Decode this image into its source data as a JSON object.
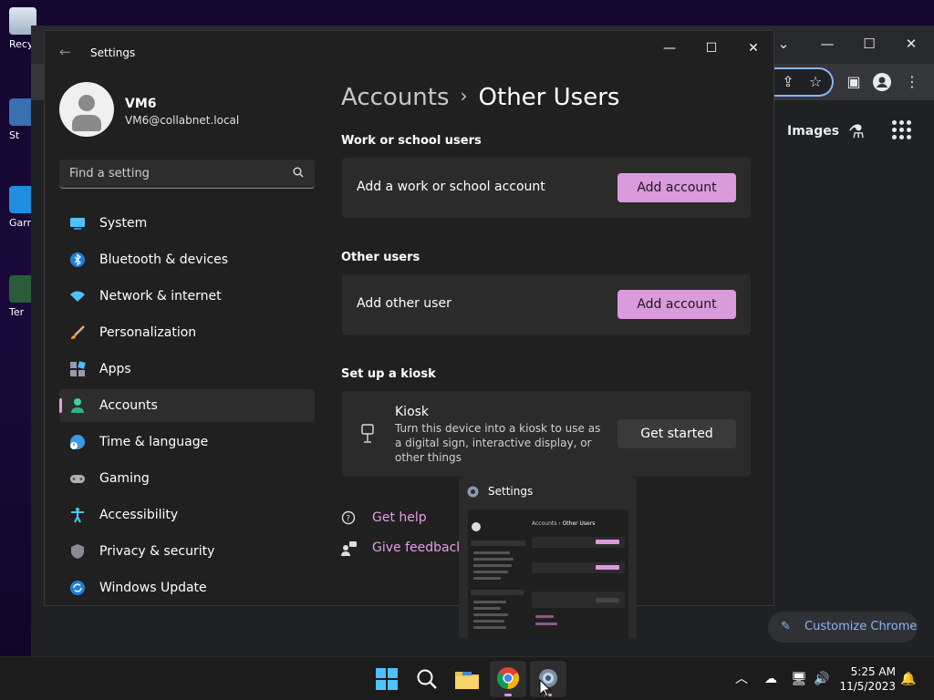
{
  "desktop": {
    "icons": [
      {
        "label": "Recy",
        "icon": "recycle-bin-icon"
      },
      {
        "label": "St",
        "icon": "shortcut-icon"
      },
      {
        "label": "Garry",
        "icon": "user-shortcut-icon"
      },
      {
        "label": "Ter",
        "icon": "terminal-shortcut-icon"
      }
    ]
  },
  "chrome": {
    "ntp_images": "Images",
    "customize_label": "Customize Chrome"
  },
  "settings": {
    "window_title": "Settings",
    "user": {
      "name": "VM6",
      "email": "VM6@collabnet.local"
    },
    "search_placeholder": "Find a setting",
    "nav": [
      {
        "label": "System",
        "icon": "system-icon"
      },
      {
        "label": "Bluetooth & devices",
        "icon": "bluetooth-icon"
      },
      {
        "label": "Network & internet",
        "icon": "wifi-icon"
      },
      {
        "label": "Personalization",
        "icon": "brush-icon"
      },
      {
        "label": "Apps",
        "icon": "apps-icon"
      },
      {
        "label": "Accounts",
        "icon": "accounts-icon",
        "active": true
      },
      {
        "label": "Time & language",
        "icon": "globe-clock-icon"
      },
      {
        "label": "Gaming",
        "icon": "gamepad-icon"
      },
      {
        "label": "Accessibility",
        "icon": "accessibility-icon"
      },
      {
        "label": "Privacy & security",
        "icon": "shield-icon"
      },
      {
        "label": "Windows Update",
        "icon": "update-icon"
      }
    ],
    "breadcrumb": {
      "parent": "Accounts",
      "separator": "›",
      "current": "Other Users"
    },
    "sections": {
      "work": {
        "heading": "Work or school users",
        "row_label": "Add a work or school account",
        "button": "Add account"
      },
      "other": {
        "heading": "Other users",
        "row_label": "Add other user",
        "button": "Add account"
      },
      "kiosk": {
        "heading": "Set up a kiosk",
        "title": "Kiosk",
        "description": "Turn this device into a kiosk to use as a digital sign, interactive display, or other things",
        "button": "Get started"
      }
    },
    "links": {
      "help": "Get help",
      "feedback": "Give feedback"
    }
  },
  "preview": {
    "title": "Settings",
    "mini_breadcrumb_parent": "Accounts",
    "mini_breadcrumb_current": "Other Users"
  },
  "taskbar": {
    "clock_time": "5:25 AM",
    "clock_date": "11/5/2023"
  },
  "colors": {
    "accent": "#d99bdc",
    "settings_bg": "#202020",
    "card_bg": "#2b2b2b",
    "taskbar_bg": "#1c1c1c"
  }
}
